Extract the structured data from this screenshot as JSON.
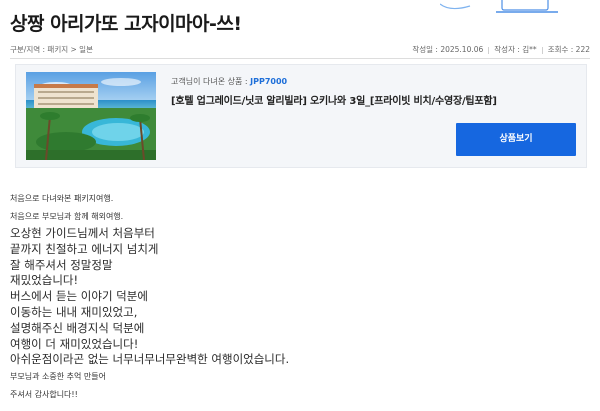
{
  "header": {
    "title": "상짱 아리가또 고자이마아-쓰!"
  },
  "meta": {
    "breadcrumb": "구분/지역 : 패키지 > 일본",
    "date": "작성일 : 2025.10.06",
    "author": "작성자 : 김**",
    "views": "조회수 : 222"
  },
  "product": {
    "label_prefix": "고객님이 다녀온 상품 : ",
    "code": "JPP7000",
    "name": "[호텔 업그레이드/닛코 알리빌라] 오키나와 3일_[프라이빗 비치/수영장/팁포함]",
    "button_label": "상품보기"
  },
  "review": {
    "lines": [
      "처음으로 다녀와본 패키지여행.",
      "처음으로 부모님과 함께 해외여행.",
      "오상현 가이드님께서 처음부터",
      "끝까지 친절하고 에너지 넘치게",
      "잘 해주셔서 정말정말",
      "재밌었습니다!",
      "버스에서 듣는 이야기 덕분에",
      "이동하는 내내 재미있었고,",
      "설명해주신 배경지식 덕분에",
      "여행이 더 재미있었습니다!",
      "아쉬운점이라곤 없는 너무너무너무완벽한 여행이었습니다.",
      "부모님과 소중한 추억 만들어",
      "주셔서 감사합니다!!"
    ]
  },
  "colors": {
    "accent": "#1667e0",
    "code": "#1e6fd9",
    "card_bg": "#f4f6f9"
  }
}
